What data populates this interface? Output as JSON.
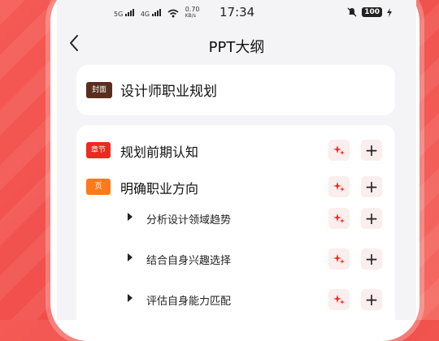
{
  "status_bar": {
    "sig1": "5G",
    "sig2": "4G",
    "net_speed": "0.70",
    "net_unit": "KB/s",
    "time": "17:34",
    "battery": "100"
  },
  "header": {
    "title": "PPT大纲"
  },
  "cover": {
    "tag": "封面",
    "title": "设计师职业规划"
  },
  "outline": {
    "chapter": {
      "tag": "章节",
      "title": "规划前期认知"
    },
    "page": {
      "tag": "页",
      "title": "明确职业方向"
    },
    "sub_items": [
      {
        "title": "分析设计领域趋势"
      },
      {
        "title": "结合自身兴趣选择"
      },
      {
        "title": "评估自身能力匹配"
      }
    ]
  },
  "colors": {
    "background": "#f2524e",
    "cover_tag": "#5a2e1e",
    "chapter_tag": "#ee2a20",
    "page_tag": "#ff7a1a",
    "ai_icon": "#ee2a20"
  },
  "icons": {
    "back": "chevron-left-icon",
    "ai": "sparkle-icon",
    "add": "plus-icon"
  }
}
